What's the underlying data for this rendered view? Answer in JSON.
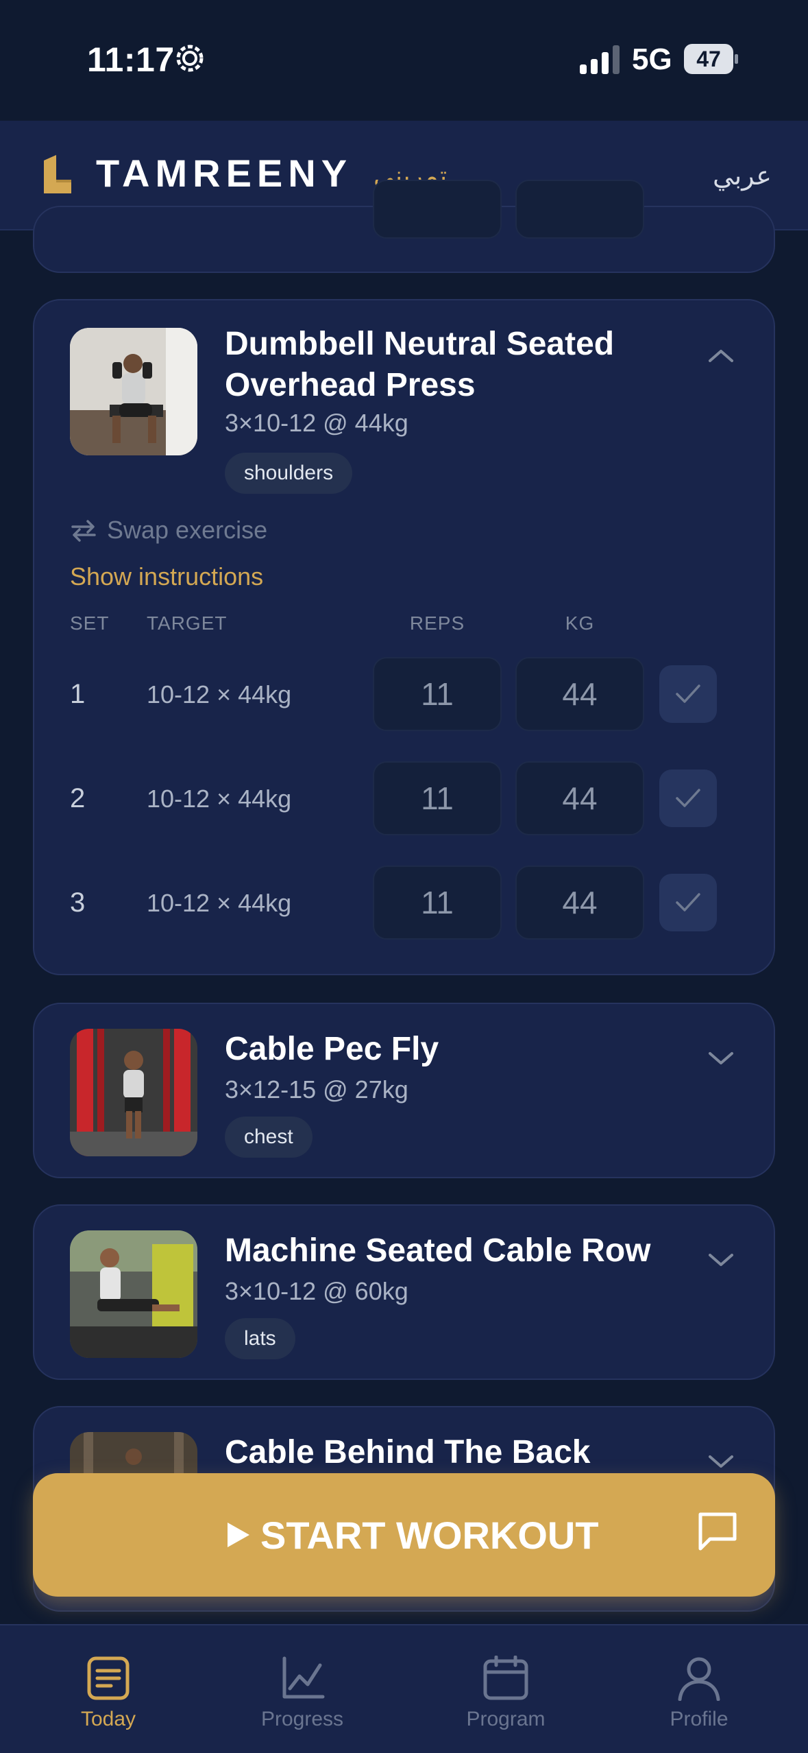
{
  "status_bar": {
    "time": "11:17",
    "network": "5G",
    "battery": "47"
  },
  "header": {
    "brand": "TAMREENY",
    "brand_arabic": "تمريني",
    "language_toggle": "عربي"
  },
  "exercises": [
    {
      "title": "Dumbbell Neutral Seated Overhead Press",
      "subtitle": "3×10-12 @ 44kg",
      "tag": "shoulders",
      "expanded": true,
      "swap_label": "Swap exercise",
      "instructions_label": "Show instructions",
      "columns": {
        "set": "SET",
        "target": "TARGET",
        "reps": "REPS",
        "kg": "KG"
      },
      "sets": [
        {
          "set": "1",
          "target": "10-12 × 44kg",
          "reps": "11",
          "kg": "44"
        },
        {
          "set": "2",
          "target": "10-12 × 44kg",
          "reps": "11",
          "kg": "44"
        },
        {
          "set": "3",
          "target": "10-12 × 44kg",
          "reps": "11",
          "kg": "44"
        }
      ]
    },
    {
      "title": "Cable Pec Fly",
      "subtitle": "3×12-15 @ 27kg",
      "tag": "chest",
      "expanded": false
    },
    {
      "title": "Machine Seated Cable Row",
      "subtitle": "3×10-12 @ 60kg",
      "tag": "lats",
      "expanded": false
    },
    {
      "title": "Cable Behind The Back",
      "expanded": false
    }
  ],
  "start_button": {
    "label": "START WORKOUT"
  },
  "nav": [
    {
      "label": "Today",
      "icon": "today-icon",
      "active": true
    },
    {
      "label": "Progress",
      "icon": "progress-chart-icon",
      "active": false
    },
    {
      "label": "Program",
      "icon": "calendar-icon",
      "active": false
    },
    {
      "label": "Profile",
      "icon": "profile-icon",
      "active": false
    }
  ],
  "colors": {
    "background": "#0f1a30",
    "card": "#18244a",
    "accent": "#d4a853",
    "muted_text": "#aab3c5"
  }
}
